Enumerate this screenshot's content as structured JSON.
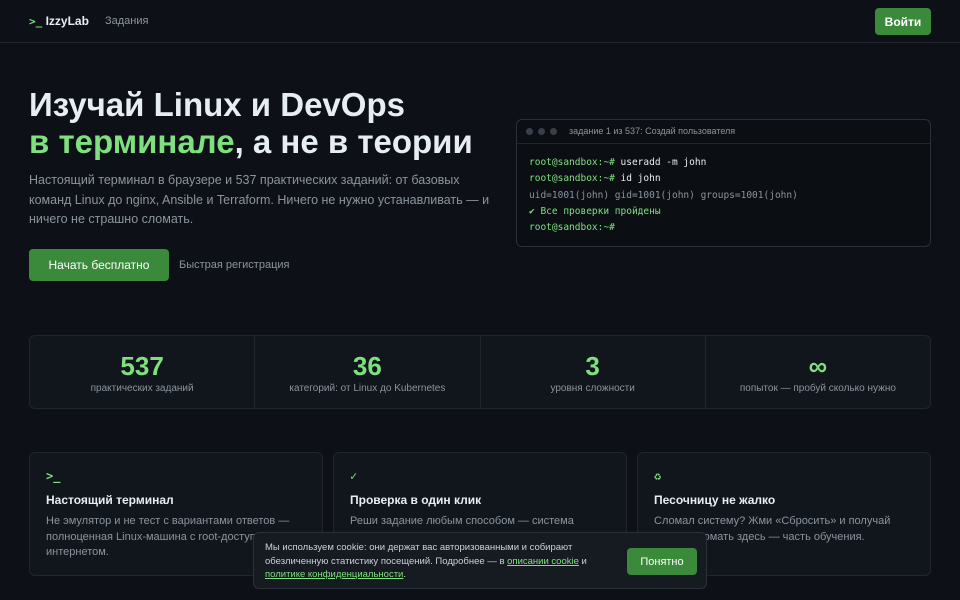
{
  "header": {
    "logo_prompt": ">_",
    "logo_text": "IzzyLab",
    "nav_tasks": "Задания",
    "login_label": "Войти"
  },
  "hero": {
    "title_line1": "Изучай Linux и DevOps",
    "title_accent": "в терминале",
    "title_rest": ", а не в теории",
    "subtitle": "Настоящий терминал в браузере и 537 практических заданий: от базовых команд Linux до nginx, Ansible и Terraform. Ничего не нужно устанавливать — и ничего не страшно сломать.",
    "cta_label": "Начать бесплатно",
    "cta_note": "Быстрая регистрация"
  },
  "terminal": {
    "title": "задание 1 из 537: Создай пользователя",
    "prompt": "root@sandbox:~#",
    "cmd1": " useradd -m john",
    "cmd2": " id john",
    "output": "uid=1001(john) gid=1001(john) groups=1001(john)",
    "success": "✔ Все проверки пройдены"
  },
  "stats": [
    {
      "value": "537",
      "label": "практических заданий"
    },
    {
      "value": "36",
      "label": "категорий: от Linux до Kubernetes"
    },
    {
      "value": "3",
      "label": "уровня сложности"
    },
    {
      "value": "∞",
      "label": "попыток — пробуй сколько нужно"
    }
  ],
  "features": [
    {
      "icon": ">_",
      "title": "Настоящий терминал",
      "text": "Не эмулятор и не тест с вариантами ответов — полноценная Linux-машина с root-доступом и интернетом."
    },
    {
      "icon": "✓",
      "title": "Проверка в один клик",
      "text": "Реши задание любым способом — система"
    },
    {
      "icon": "♻",
      "title": "Песочницу не жалко",
      "text": "Сломал систему? Жми «Сбросить» и получай чистую. Ломать здесь — часть обучения."
    }
  ],
  "cookie": {
    "text_before": "Мы используем cookie: они держат вас авторизованными и собирают обезличенную статистику посещений. Подробнее — в ",
    "link1": "описании cookie",
    "text_mid": " и ",
    "link2": "политике конфиденциальности",
    "text_after": ".",
    "accept_label": "Понятно"
  },
  "colors": {
    "background": "#0d1117",
    "accent": "#7ee07e",
    "button": "#3b8a3b"
  }
}
